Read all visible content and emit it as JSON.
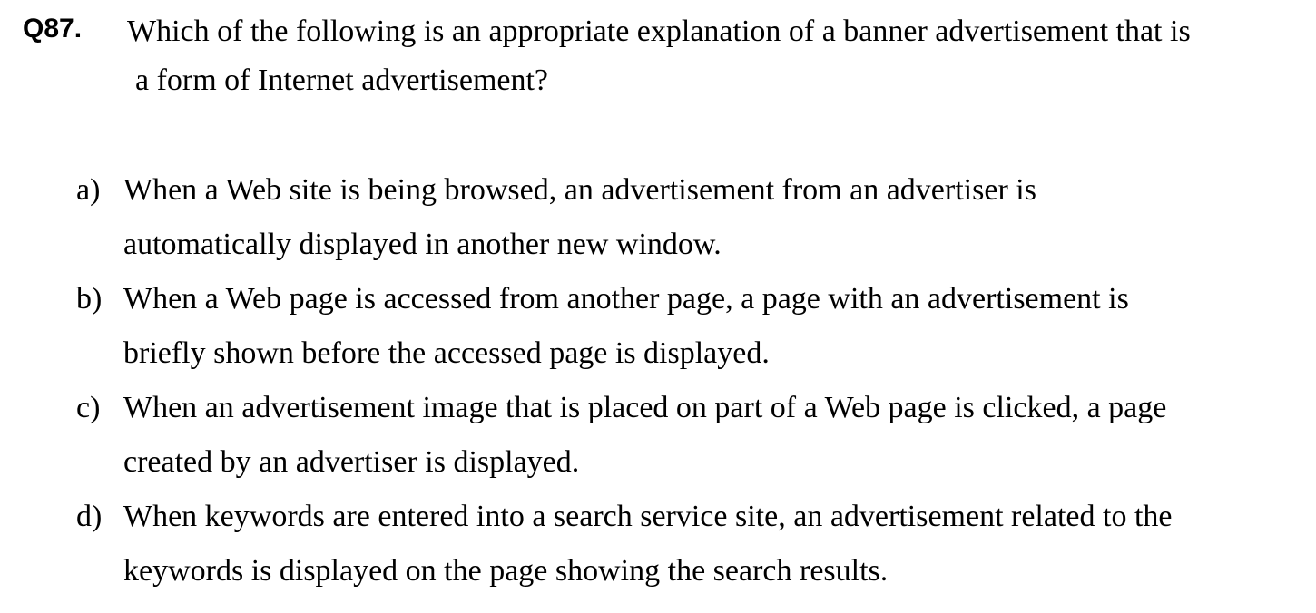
{
  "question": {
    "number": "Q87.",
    "text_line1": "Which of the following is an appropriate explanation of a banner advertisement that is",
    "text_line2": "a form of Internet advertisement?"
  },
  "options": [
    {
      "label": "a)",
      "line1": "When a Web site is being browsed, an advertisement from an advertiser is",
      "line2": "automatically displayed in another new window."
    },
    {
      "label": "b)",
      "line1": "When a Web page is accessed from another page, a page with an advertisement is",
      "line2": "briefly shown before the accessed page is displayed."
    },
    {
      "label": "c)",
      "line1": "When an advertisement image that is placed on part of a Web page is clicked, a page",
      "line2": "created by an advertiser is displayed."
    },
    {
      "label": "d)",
      "line1": "When keywords are entered into a search service site, an advertisement related to the",
      "line2": "keywords is displayed on the page showing the search results."
    }
  ]
}
